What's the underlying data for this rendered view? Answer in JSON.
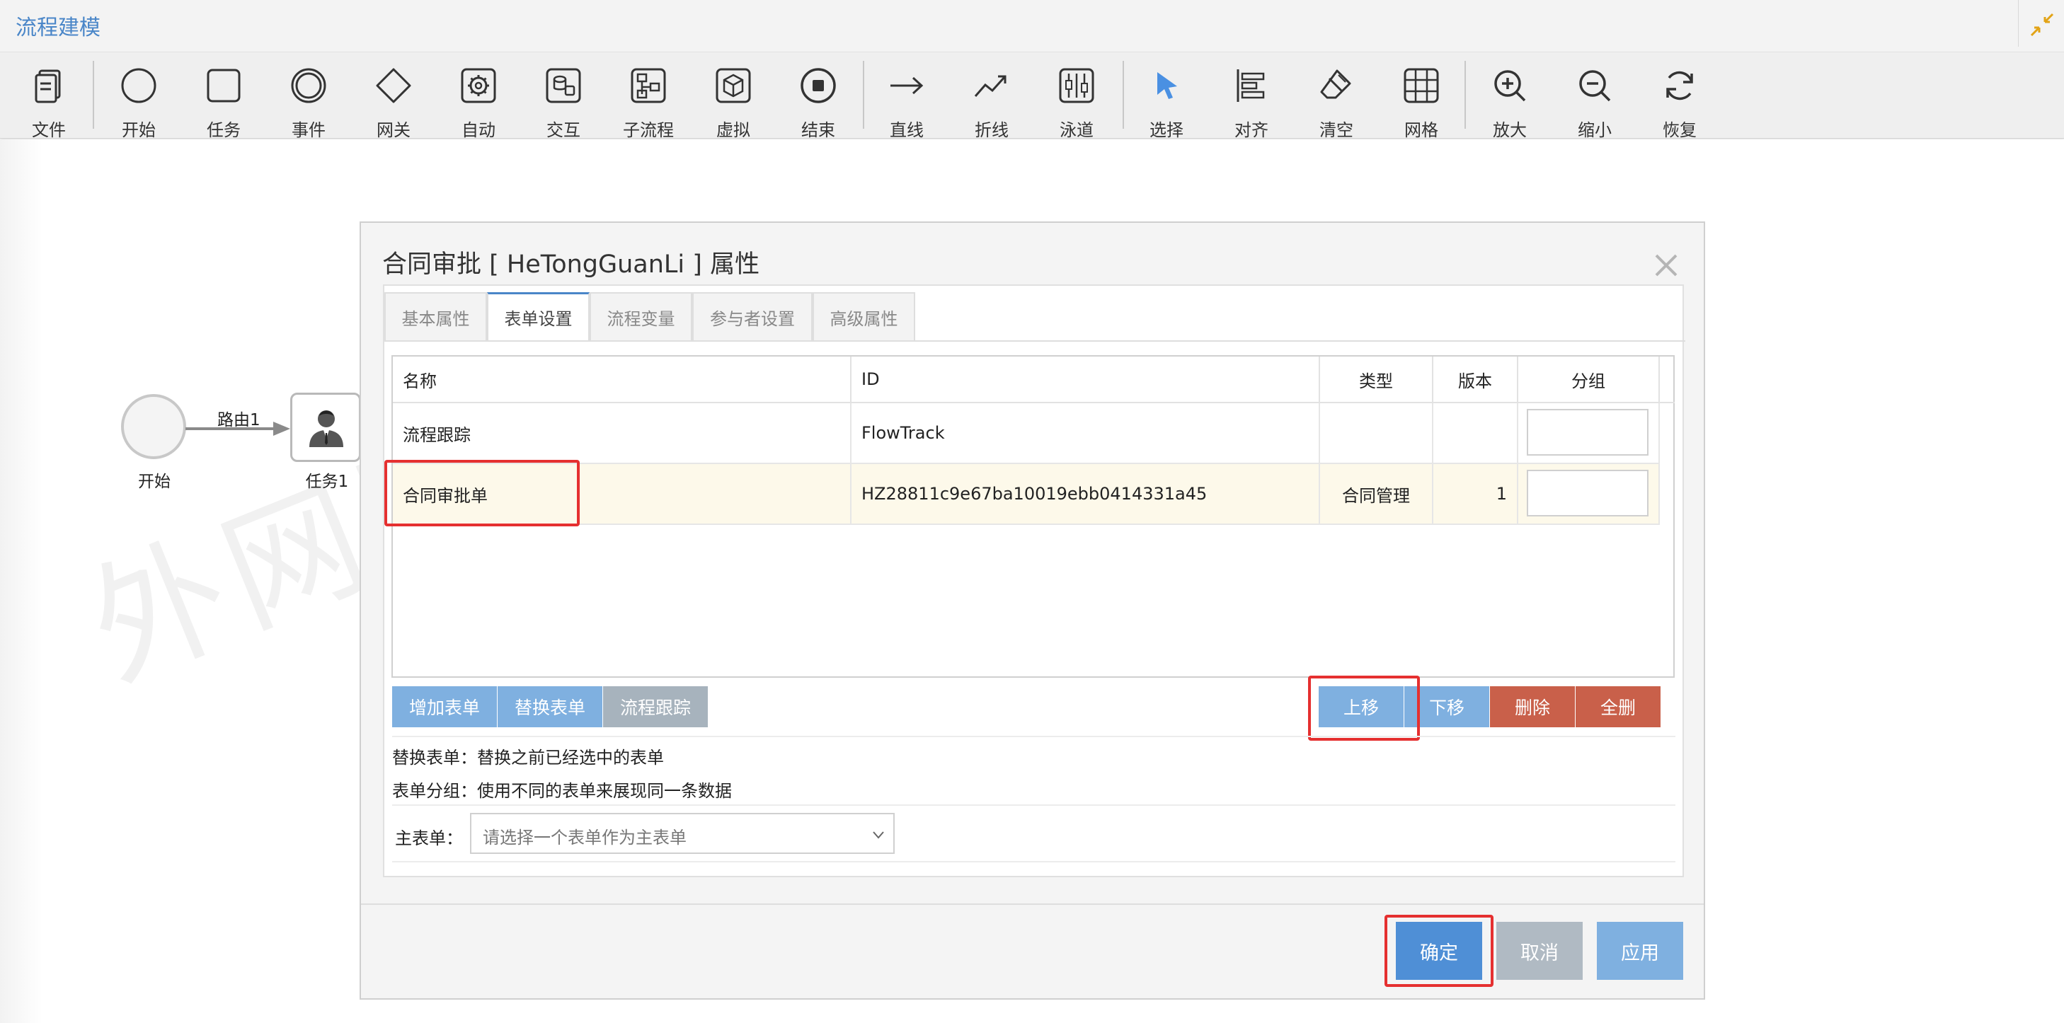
{
  "app": {
    "title": "流程建模"
  },
  "colors": {
    "accent": "#4a86c8",
    "button_blue": "#7fb0e0",
    "button_gray": "#a7b3bd",
    "button_red": "#c9604a",
    "highlight_red": "#e53030",
    "confirm_blue": "#4f8fd6",
    "selected_row": "#fdf9ea"
  },
  "toolbar": {
    "items": [
      {
        "label": "文件",
        "icon": "file-icon"
      },
      {
        "label": "开始",
        "icon": "start-circle-icon"
      },
      {
        "label": "任务",
        "icon": "task-square-icon"
      },
      {
        "label": "事件",
        "icon": "event-circle-icon"
      },
      {
        "label": "网关",
        "icon": "gateway-diamond-icon"
      },
      {
        "label": "自动",
        "icon": "auto-gear-icon"
      },
      {
        "label": "交互",
        "icon": "interaction-icon"
      },
      {
        "label": "子流程",
        "icon": "subprocess-icon"
      },
      {
        "label": "虚拟",
        "icon": "virtual-icon"
      },
      {
        "label": "结束",
        "icon": "end-circle-icon"
      },
      {
        "label": "直线",
        "icon": "arrow-right-icon"
      },
      {
        "label": "折线",
        "icon": "polyline-icon"
      },
      {
        "label": "泳道",
        "icon": "swimlane-icon"
      },
      {
        "label": "选择",
        "icon": "cursor-icon"
      },
      {
        "label": "对齐",
        "icon": "align-icon"
      },
      {
        "label": "清空",
        "icon": "eraser-icon"
      },
      {
        "label": "网格",
        "icon": "grid-icon"
      },
      {
        "label": "放大",
        "icon": "zoom-in-icon"
      },
      {
        "label": "缩小",
        "icon": "zoom-out-icon"
      },
      {
        "label": "恢复",
        "icon": "refresh-icon"
      }
    ]
  },
  "canvas": {
    "watermark": "外网服",
    "start_node": {
      "label": "开始"
    },
    "route": {
      "label": "路由1"
    },
    "task_node": {
      "label": "任务1"
    }
  },
  "dialog": {
    "title": "合同审批 [ HeTongGuanLi ] 属性",
    "tabs": [
      {
        "label": "基本属性",
        "active": false
      },
      {
        "label": "表单设置",
        "active": true
      },
      {
        "label": "流程变量",
        "active": false
      },
      {
        "label": "参与者设置",
        "active": false
      },
      {
        "label": "高级属性",
        "active": false
      }
    ],
    "grid": {
      "columns": [
        "名称",
        "ID",
        "类型",
        "版本",
        "分组"
      ],
      "rows": [
        {
          "name": "流程跟踪",
          "id": "FlowTrack",
          "type": "",
          "version": "",
          "group": ""
        },
        {
          "name": "合同审批单",
          "id": "HZ28811c9e67ba10019ebb0414331a45",
          "type": "合同管理",
          "version": "1",
          "group": ""
        }
      ]
    },
    "buttons_left": {
      "add": "增加表单",
      "replace": "替换表单",
      "track": "流程跟踪"
    },
    "buttons_right": {
      "up": "上移",
      "down": "下移",
      "delete": "删除",
      "delete_all": "全删"
    },
    "info": {
      "replace_note": "替换表单：替换之前已经选中的表单",
      "group_note": "表单分组：使用不同的表单来展现同一条数据"
    },
    "main_form": {
      "label": "主表单：",
      "placeholder": "请选择一个表单作为主表单"
    },
    "footer": {
      "ok": "确定",
      "cancel": "取消",
      "apply": "应用"
    }
  }
}
